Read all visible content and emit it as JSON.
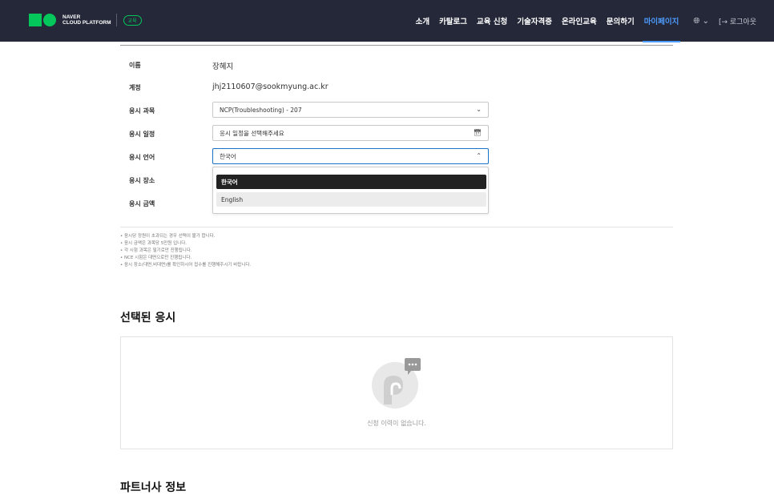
{
  "header": {
    "brand_line1": "NAVER",
    "brand_line2": "CLOUD PLATFORM",
    "badge": "교육",
    "nav": [
      "소개",
      "카탈로그",
      "교육 신청",
      "기술자격증",
      "온라인교육",
      "문의하기",
      "마이페이지"
    ],
    "active_nav": "마이페이지",
    "lang_icon": "globe-icon",
    "logout_label": "로그아웃"
  },
  "form": {
    "name_label": "이름",
    "name_value": "장혜지",
    "account_label": "계정",
    "account_value": "jhj2110607@sookmyung.ac.kr",
    "subject_label": "응시 과목",
    "subject_value": "NCP(Troubleshooting) - 207",
    "date_label": "응시 일정",
    "date_placeholder": "응시 일정을 선택해주세요",
    "language_label": "응시 언어",
    "language_value": "한국어",
    "place_label": "응시 장소",
    "fee_label": "응시 금액",
    "language_options": [
      "한국어",
      "English"
    ]
  },
  "notes": [
    "• 응시당 정원이 초과되는 경우 선택이 불가 합니다.",
    "• 응시 금액은 과목당 5만원 입니다.",
    "• 각 시험 과목은 필기로만 진행됩니다.",
    "• NCE 시험은 대면으로만 진행됩니다.",
    "• 응시 장소(대면,비대면)를 확인하시어 접수를 진행해주시기 바랍니다."
  ],
  "selected": {
    "title": "선택된 응시",
    "empty_text": "신청 이력이 없습니다."
  },
  "partner_title": "파트너사 정보",
  "colors": {
    "header_bg": "#242838",
    "brand_green": "#03c75a",
    "active_blue": "#4d9bff"
  }
}
